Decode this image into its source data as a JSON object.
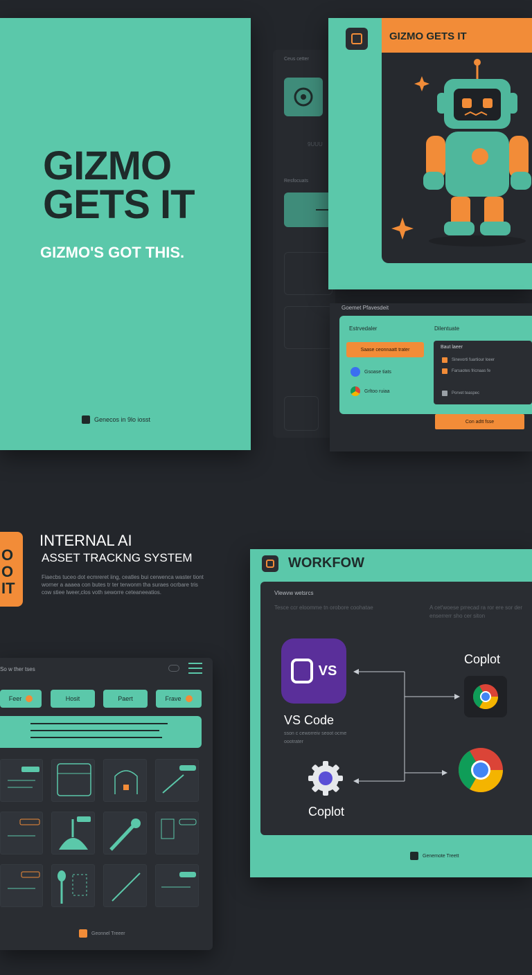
{
  "cover": {
    "title": "GIZMO GETS IT",
    "tagline": "GIZMO'S GOT THIS.",
    "footer": "Genecos in 9lo iosst"
  },
  "ghost_panel": {
    "label": "Ceus cetter",
    "item_code": "9UUU",
    "subhead": "Resfocuats"
  },
  "hero": {
    "title": "GIZMO GETS IT"
  },
  "config": {
    "label": "Goemet Pfavesdeit",
    "sub_left": "Estrvedaler",
    "sub_right": "Dilentuate",
    "primary_button": "Saase ceonnaatt trater",
    "options": [
      "Gsoase tiats",
      "Grltoo ruiaa"
    ],
    "list_title": "Baut laeer",
    "list_rows": [
      "Sinevorti fuartiour loeer",
      "Farsaotes fricnaas fe",
      "Porvet teaspec"
    ],
    "cta": "Con adtt fsse"
  },
  "asset": {
    "logo_text": "O\nO\nIT",
    "title": "INTERNAL AI",
    "subtitle": "ASSET TRACKNG SYSTEM",
    "description": "Fiaecbs tuceo dot ecmreret iing, ceatles bui cerwenca waster tiont worner a aaaea con butes tr ter terwonm tha suraes ocrbare tris cow stiee lweer,clos voth seworre ceteaneeatios.",
    "bar_title": "So w ther tses",
    "tabs": [
      "Feer",
      "Hosit",
      "Paert",
      "Frave"
    ],
    "footer": "Geonnel Treeer"
  },
  "workflow": {
    "title": "WORKFOW",
    "view_label": "Vlewvw wetsrcs",
    "note_left": "Tesce ccr eloomme tn orobore coohatae",
    "note_right": "A cet'woese prrecad ra ror ere sor der enserrerr sho cer siton",
    "vs_badge_text": "VS",
    "vs_label": "VS Code",
    "vs_sub": "sson c ceworreiv seoot ocme oootrater",
    "copilot_left": "Coplot",
    "copilot_top": "Coplot",
    "footer": "Genemote Treett"
  },
  "colors": {
    "teal": "#5bc8aa",
    "orange": "#f28c38",
    "dark": "#2a2d32",
    "background": "#23262b",
    "vscode_purple": "#5a2f9a"
  }
}
